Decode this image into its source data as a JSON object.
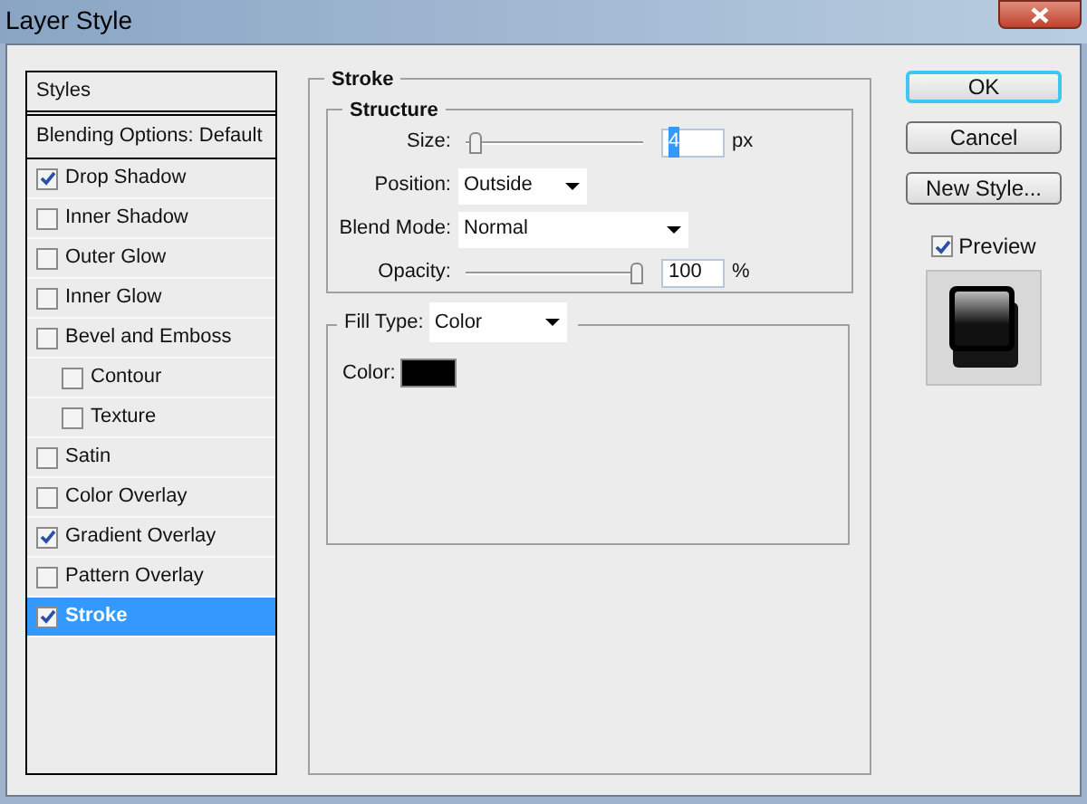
{
  "window": {
    "title": "Layer Style"
  },
  "sidebar": {
    "items": [
      {
        "kind": "header",
        "label": "Styles",
        "selected": false
      },
      {
        "kind": "option",
        "label": "Blending Options: Default",
        "selected": false
      },
      {
        "kind": "effect",
        "label": "Drop Shadow",
        "checked": true,
        "selected": false
      },
      {
        "kind": "effect",
        "label": "Inner Shadow",
        "checked": false,
        "selected": false
      },
      {
        "kind": "effect",
        "label": "Outer Glow",
        "checked": false,
        "selected": false
      },
      {
        "kind": "effect",
        "label": "Inner Glow",
        "checked": false,
        "selected": false
      },
      {
        "kind": "effect",
        "label": "Bevel and Emboss",
        "checked": false,
        "selected": false,
        "children": [
          {
            "kind": "effect",
            "label": "Contour",
            "checked": false,
            "selected": false
          },
          {
            "kind": "effect",
            "label": "Texture",
            "checked": false,
            "selected": false
          }
        ]
      },
      {
        "kind": "effect",
        "label": "Satin",
        "checked": false,
        "selected": false
      },
      {
        "kind": "effect",
        "label": "Color Overlay",
        "checked": false,
        "selected": false
      },
      {
        "kind": "effect",
        "label": "Gradient Overlay",
        "checked": true,
        "selected": false
      },
      {
        "kind": "effect",
        "label": "Pattern Overlay",
        "checked": false,
        "selected": false
      },
      {
        "kind": "effect",
        "label": "Stroke",
        "checked": true,
        "selected": true
      }
    ]
  },
  "panel": {
    "title": "Stroke",
    "structure": {
      "title": "Structure",
      "rows": [
        {
          "kind": "slider",
          "label": "Size:",
          "level": 0.02,
          "value": "4",
          "unit": "px"
        },
        {
          "kind": "select",
          "label": "Position:",
          "value": "Outside"
        },
        {
          "kind": "select",
          "label": "Blend Mode:",
          "value": "Normal"
        },
        {
          "kind": "slider",
          "label": "Opacity:",
          "level": 1,
          "value": "100",
          "unit": "%"
        }
      ]
    },
    "fill": {
      "label": "Fill Type:",
      "value": "Color",
      "color_label": "Color:",
      "color": "#000000"
    }
  },
  "buttons": [
    {
      "label": "OK",
      "default": true
    },
    {
      "label": "Cancel",
      "default": false
    },
    {
      "label": "New Style...",
      "default": false
    }
  ],
  "preview": {
    "label": "Preview",
    "checked": true
  }
}
